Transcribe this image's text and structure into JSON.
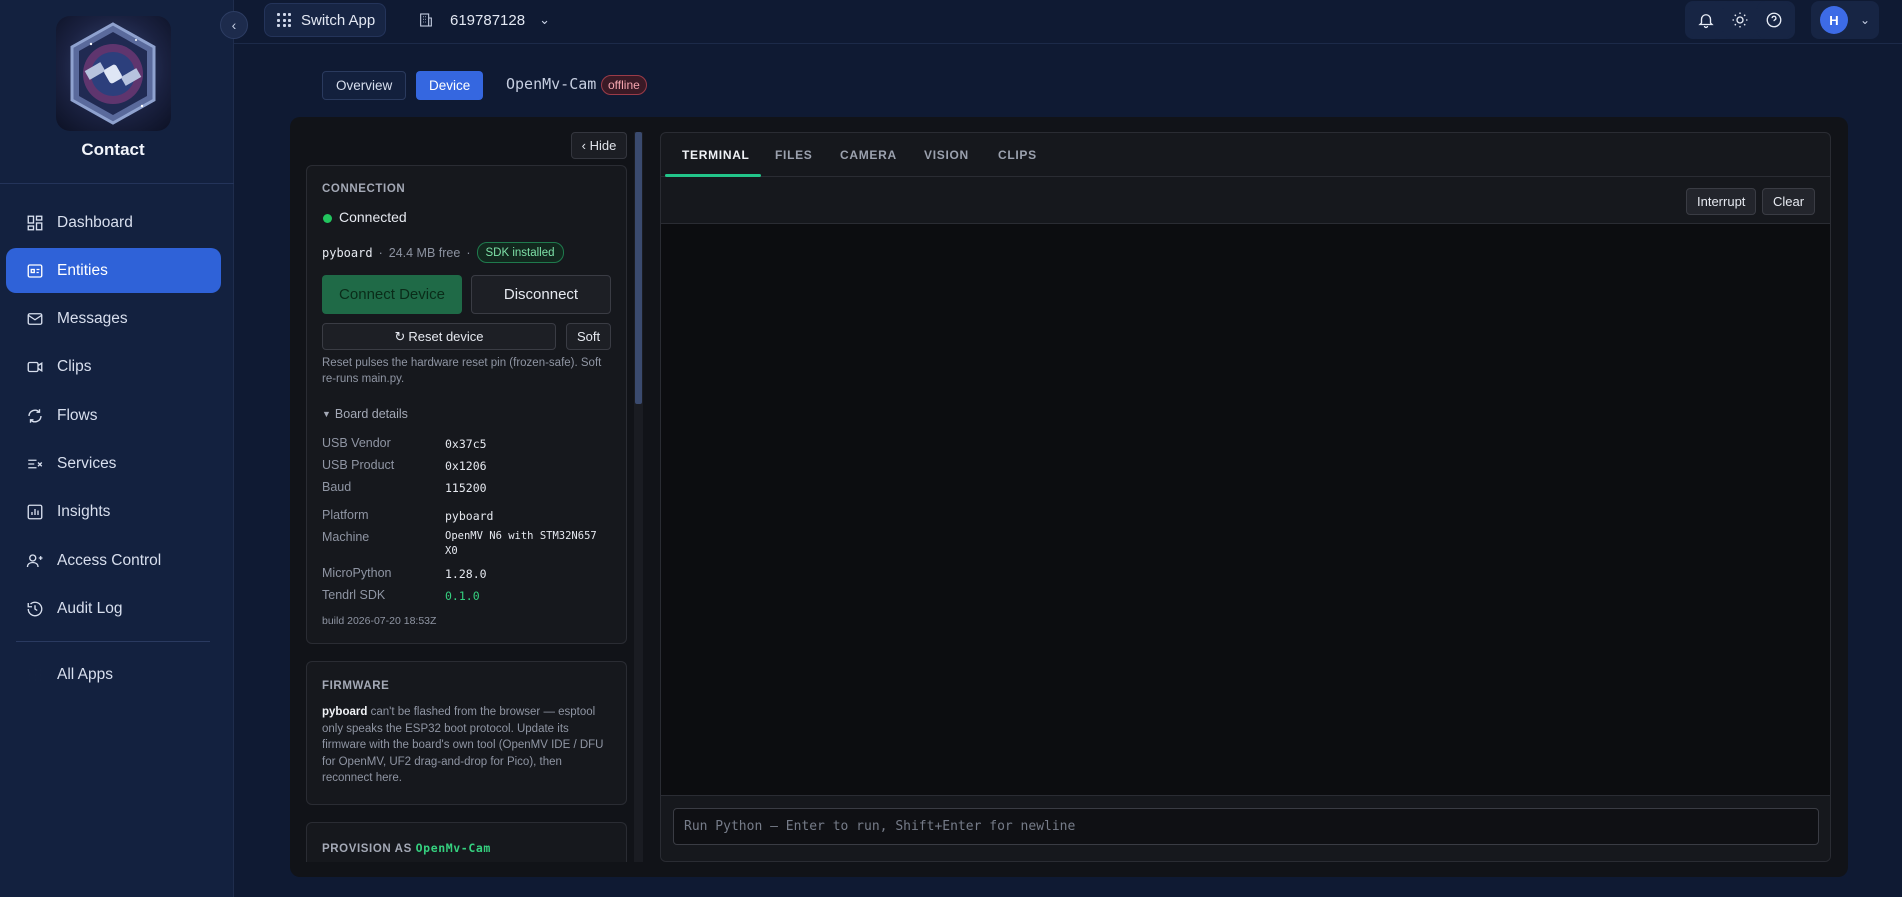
{
  "brand": "Contact",
  "sidebar": {
    "items": [
      {
        "label": "Dashboard",
        "icon": "grid-icon"
      },
      {
        "label": "Entities",
        "icon": "entities-icon",
        "active": true
      },
      {
        "label": "Messages",
        "icon": "mail-icon"
      },
      {
        "label": "Clips",
        "icon": "video-icon"
      },
      {
        "label": "Flows",
        "icon": "refresh-icon"
      },
      {
        "label": "Services",
        "icon": "services-icon"
      },
      {
        "label": "Insights",
        "icon": "chart-icon"
      },
      {
        "label": "Access Control",
        "icon": "users-icon"
      },
      {
        "label": "Audit Log",
        "icon": "history-icon"
      }
    ],
    "all_apps": "All Apps"
  },
  "topbar": {
    "switch_app": "Switch App",
    "org_id": "619787128",
    "user_initial": "H"
  },
  "page_tabs": {
    "overview": "Overview",
    "device": "Device"
  },
  "device": {
    "name": "OpenMv-Cam",
    "status": "offline"
  },
  "hide_label": "‹ Hide",
  "connection": {
    "title": "CONNECTION",
    "status": "Connected",
    "board": "pyboard",
    "free": "24.4 MB free",
    "sdk_badge": "SDK installed",
    "connect_label": "Connect Device",
    "disconnect_label": "Disconnect",
    "reset_label": "Reset device",
    "soft_label": "Soft",
    "reset_note": "Reset pulses the hardware reset pin (frozen-safe). Soft re-runs main.py.",
    "details_toggle": "Board details",
    "details": {
      "usb_vendor_label": "USB Vendor",
      "usb_vendor": "0x37c5",
      "usb_product_label": "USB Product",
      "usb_product": "0x1206",
      "baud_label": "Baud",
      "baud": "115200",
      "platform_label": "Platform",
      "platform": "pyboard",
      "machine_label": "Machine",
      "machine_line1": "OpenMV N6 with STM32N657",
      "machine_line2": "X0",
      "micropython_label": "MicroPython",
      "micropython": "1.28.0",
      "sdk_label": "Tendrl SDK",
      "sdk": "0.1.0"
    },
    "build": "build 2026-07-20 18:53Z"
  },
  "firmware": {
    "title": "FIRMWARE",
    "board": "pyboard",
    "text": "can't be flashed from the browser — esptool only speaks the ESP32 boot protocol. Update its firmware with the board's own tool (OpenMV IDE / DFU for OpenMV, UF2 drag-and-drop for Pico), then reconnect here."
  },
  "provision": {
    "title": "PROVISION AS",
    "name": "OpenMv-Cam"
  },
  "panel": {
    "tabs": [
      "TERMINAL",
      "FILES",
      "CAMERA",
      "VISION",
      "CLIPS"
    ],
    "interrupt": "Interrupt",
    "clear": "Clear",
    "input_placeholder": "Run Python — Enter to run, Shift+Enter for newline"
  }
}
